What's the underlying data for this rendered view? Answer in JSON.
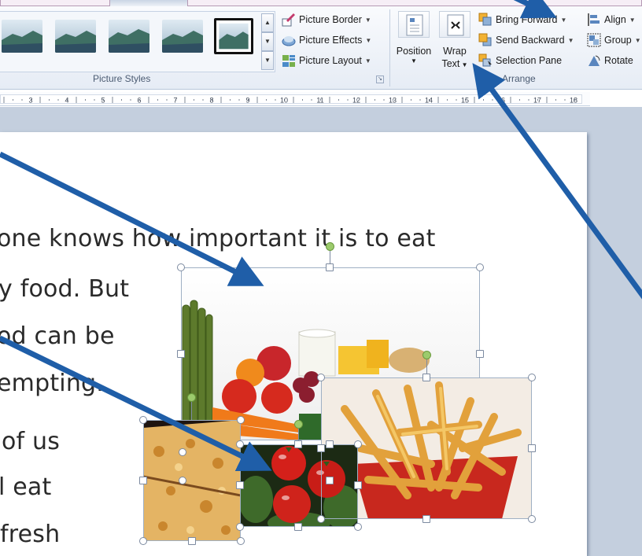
{
  "ribbon": {
    "picture_styles_group": {
      "label": "Picture Styles",
      "commands": {
        "border": "Picture Border",
        "effects": "Picture Effects",
        "layout": "Picture Layout"
      }
    },
    "arrange_group": {
      "label": "Arrange",
      "position": "Position",
      "wrap_text_line1": "Wrap",
      "wrap_text_line2": "Text",
      "bring_forward": "Bring Forward",
      "send_backward": "Send Backward",
      "selection_pane": "Selection Pane",
      "align": "Align",
      "group": "Group",
      "rotate": "Rotate"
    }
  },
  "ruler": {
    "numbers": [
      "3",
      "4",
      "5",
      "6",
      "7",
      "8",
      "9",
      "10",
      "11",
      "12",
      "13",
      "14",
      "15",
      "16",
      "17",
      "18"
    ]
  },
  "document": {
    "lines": [
      "one knows how important it is to eat",
      "y food. But",
      "od can be",
      "empting.",
      "of us",
      "l eat",
      "fresh"
    ]
  },
  "colors": {
    "arrow": "#1f5ea8",
    "handle_border": "#7c8aa0",
    "rotate_handle": "#9ccb6c"
  }
}
